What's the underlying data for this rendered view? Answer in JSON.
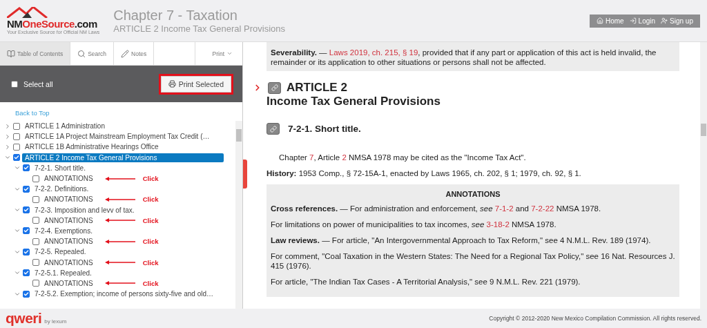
{
  "header": {
    "logo": {
      "parts": [
        {
          "text": "NM",
          "accent": false
        },
        {
          "text": "OneSource",
          "accent": true
        },
        {
          "text": ".com",
          "accent": false
        }
      ],
      "tagline": "Your Exclusive Source for Official NM Laws"
    },
    "title": "Chapter 7 - Taxation",
    "subtitle": "ARTICLE 2 Income Tax General Provisions",
    "nav": [
      {
        "kind": "home",
        "label": "Home"
      },
      {
        "kind": "login",
        "label": "Login"
      },
      {
        "kind": "signup",
        "label": "Sign up"
      }
    ]
  },
  "sidebar": {
    "tabs": [
      {
        "kind": "book",
        "label": "Table of Contents",
        "selected": true
      },
      {
        "kind": "search",
        "label": "Search",
        "selected": false
      },
      {
        "kind": "pencil",
        "label": "Notes",
        "selected": false
      }
    ],
    "print_menu": {
      "label": "Print"
    },
    "select_all": {
      "label": "Select all",
      "checked": false
    },
    "print_button": {
      "label": "Print Selected",
      "highlighted": true
    },
    "back_to_top": "Back to Top",
    "tree": [
      {
        "label": "ARTICLE 1 Administration",
        "checked": false,
        "expanded": false,
        "selected": false
      },
      {
        "label": "ARTICLE 1A Project Mainstream Employment Tax Credit (…",
        "checked": false,
        "expanded": false,
        "selected": false
      },
      {
        "label": "ARTICLE 1B Administrative Hearings Office",
        "checked": false,
        "expanded": false,
        "selected": false
      },
      {
        "label": "ARTICLE 2 Income Tax General Provisions",
        "checked": true,
        "expanded": true,
        "selected": true,
        "children": [
          {
            "label": "7-2-1. Short title.",
            "checked": true,
            "expanded": true,
            "selected": false,
            "children": [
              {
                "label": "ANNOTATIONS",
                "checked": false,
                "selected": false,
                "callout": "Click"
              }
            ]
          },
          {
            "label": "7-2-2. Definitions.",
            "checked": true,
            "expanded": true,
            "selected": false,
            "children": [
              {
                "label": "ANNOTATIONS",
                "checked": false,
                "selected": false,
                "callout": "Click"
              }
            ]
          },
          {
            "label": "7-2-3. Imposition and levv of tax.",
            "checked": true,
            "expanded": true,
            "selected": false,
            "children": [
              {
                "label": "ANNOTATIONS",
                "checked": false,
                "selected": false,
                "callout": "Click"
              }
            ]
          },
          {
            "label": "7-2-4. Exemptions.",
            "checked": true,
            "expanded": true,
            "selected": false,
            "children": [
              {
                "label": "ANNOTATIONS",
                "checked": false,
                "selected": false,
                "callout": "Click"
              }
            ]
          },
          {
            "label": "7-2-5. Repealed.",
            "checked": true,
            "expanded": true,
            "selected": false,
            "children": [
              {
                "label": "ANNOTATIONS",
                "checked": false,
                "selected": false,
                "callout": "Click"
              }
            ]
          },
          {
            "label": "7-2-5.1. Repealed.",
            "checked": true,
            "expanded": true,
            "selected": false,
            "children": [
              {
                "label": "ANNOTATIONS",
                "checked": false,
                "selected": false,
                "callout": "Click"
              }
            ]
          },
          {
            "label": "7-2-5.2. Exemption; income of persons sixty-five and old…",
            "checked": true,
            "expanded": true,
            "selected": false
          }
        ]
      }
    ]
  },
  "content": {
    "severability": [
      {
        "kind": "bold",
        "text": "Severability."
      },
      {
        "kind": "plain",
        "text": " — "
      },
      {
        "kind": "link",
        "text": "Laws 2019, ch. 215, § 19"
      },
      {
        "kind": "plain",
        "text": ", provided that if any part or application of this act is held invalid, the remainder or its application to other situations or persons shall not be affected."
      }
    ],
    "article": {
      "number": "ARTICLE 2",
      "title": "Income Tax General Provisions"
    },
    "section": {
      "title": "7-2-1. Short title."
    },
    "body": [
      {
        "kind": "plain",
        "text": "Chapter "
      },
      {
        "kind": "link",
        "text": "7"
      },
      {
        "kind": "plain",
        "text": ", Article "
      },
      {
        "kind": "link",
        "text": "2"
      },
      {
        "kind": "plain",
        "text": " NMSA 1978 may be cited as the \"Income Tax Act\"."
      }
    ],
    "history": [
      {
        "kind": "bold",
        "text": "History:"
      },
      {
        "kind": "plain",
        "text": " 1953 Comp., § 72-15A-1, enacted by Laws 1965, ch. 202, § 1; 1979, ch. 92, § 1."
      }
    ],
    "annotations": {
      "heading": "ANNOTATIONS",
      "paragraphs": [
        [
          {
            "kind": "bold",
            "text": "Cross references."
          },
          {
            "kind": "plain",
            "text": " — For administration and enforcement, "
          },
          {
            "kind": "italic",
            "text": "see "
          },
          {
            "kind": "link",
            "text": "7-1-2"
          },
          {
            "kind": "plain",
            "text": " and "
          },
          {
            "kind": "link",
            "text": "7-2-22"
          },
          {
            "kind": "plain",
            "text": " NMSA 1978."
          }
        ],
        [
          {
            "kind": "plain",
            "text": "For limitations on power of municipalities to tax incomes, "
          },
          {
            "kind": "italic",
            "text": "see "
          },
          {
            "kind": "link",
            "text": "3-18-2"
          },
          {
            "kind": "plain",
            "text": " NMSA 1978."
          }
        ],
        [
          {
            "kind": "bold",
            "text": "Law reviews."
          },
          {
            "kind": "plain",
            "text": " — For article, \"An Intergovernmental Approach to Tax Reform,\" see 4 N.M.L. Rev. 189 (1974)."
          }
        ],
        [
          {
            "kind": "plain",
            "text": "For comment, \"Coal Taxation in the Western States: The Need for a Regional Tax Policy,\" see 16 Nat. Resources J. 415 (1976)."
          }
        ],
        [
          {
            "kind": "plain",
            "text": "For article, \"The Indian Tax Cases - A Territorial Analysis,\" see 9 N.M.L. Rev. 221 (1979)."
          }
        ]
      ]
    }
  },
  "footer": {
    "brand": "qweri",
    "brand_by": "by lexum",
    "copyright": "Copyright © 2012-2020 New Mexico Compilation Commission. All rights reserved."
  }
}
